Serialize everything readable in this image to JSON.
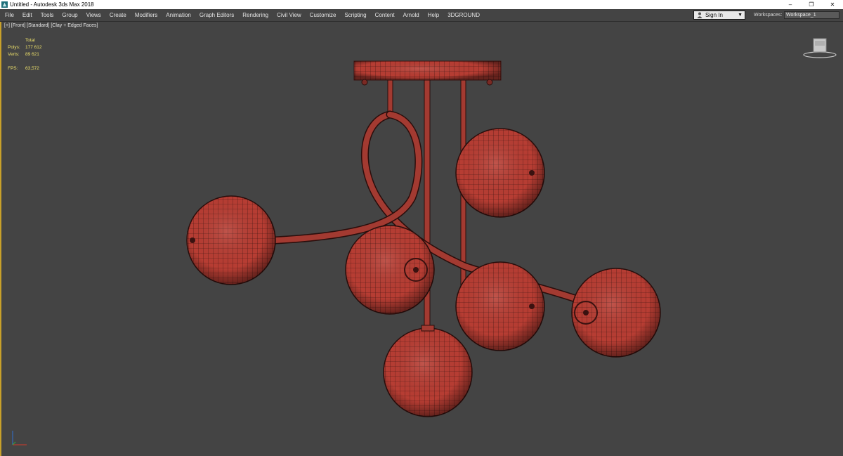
{
  "window": {
    "title": "Untitled - Autodesk 3ds Max 2018",
    "controls": {
      "minimize": "–",
      "maximize": "❐",
      "close": "✕"
    }
  },
  "menubar": {
    "items": [
      "File",
      "Edit",
      "Tools",
      "Group",
      "Views",
      "Create",
      "Modifiers",
      "Animation",
      "Graph Editors",
      "Rendering",
      "Civil View",
      "Customize",
      "Scripting",
      "Content",
      "Arnold",
      "Help",
      "3DGROUND"
    ],
    "sign_in": "Sign In",
    "workspaces_label": "Workspaces:",
    "workspace_value": "Workspace_1"
  },
  "viewport": {
    "label": "[+] [Front] [Standard] [Clay + Edged Faces]",
    "stats": {
      "header": "Total",
      "polys_label": "Polys:",
      "polys_value": "177 612",
      "verts_label": "Verts:",
      "verts_value": "89 621",
      "fps_label": "FPS:",
      "fps_value": "63,572"
    },
    "model_color": "#b83c33",
    "background_color": "#444444"
  }
}
